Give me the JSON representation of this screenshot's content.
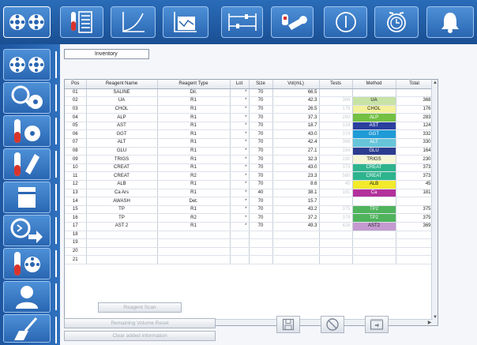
{
  "search": {
    "value": "Inventory"
  },
  "table": {
    "columns": [
      "Pos",
      "Reagent Name",
      "Reagent Type",
      "Lot",
      "Size",
      "Vol(mL)",
      "Tests",
      "Method",
      "Total"
    ],
    "rows": [
      {
        "pos": "01",
        "name": "SALINE",
        "type": "Dil.",
        "lot": "*",
        "size": "70",
        "vol": "66.5",
        "tests": "",
        "method": "",
        "method_color": "",
        "total": ""
      },
      {
        "pos": "02",
        "name": "UA",
        "type": "R1",
        "lot": "*",
        "size": "70",
        "vol": "42.3",
        "tests": "368",
        "method": "UA",
        "method_color": "#c7e3a6",
        "total": "368"
      },
      {
        "pos": "03",
        "name": "CHOL",
        "type": "R1",
        "lot": "*",
        "size": "70",
        "vol": "26.5",
        "tests": "176",
        "method": "CHOL",
        "method_color": "#f3f19a",
        "total": "176"
      },
      {
        "pos": "04",
        "name": "ALP",
        "type": "R1",
        "lot": "*",
        "size": "70",
        "vol": "37.3",
        "tests": "283",
        "method": "ALP",
        "method_color": "#74c043",
        "total": "283"
      },
      {
        "pos": "05",
        "name": "AST",
        "type": "R1",
        "lot": "*",
        "size": "70",
        "vol": "18.7",
        "tests": "124",
        "method": "AST",
        "method_color": "#2a3f9e",
        "total": "124"
      },
      {
        "pos": "06",
        "name": "GGT",
        "type": "R1",
        "lot": "*",
        "size": "70",
        "vol": "43.0",
        "tests": "374",
        "method": "GGT",
        "method_color": "#1f9bd7",
        "total": "332"
      },
      {
        "pos": "07",
        "name": "ALT",
        "type": "R1",
        "lot": "*",
        "size": "70",
        "vol": "42.4",
        "tests": "368",
        "method": "ALT",
        "method_color": "#67c5d9",
        "total": "330"
      },
      {
        "pos": "08",
        "name": "GLU",
        "type": "R1",
        "lot": "*",
        "size": "70",
        "vol": "27.1",
        "tests": "164",
        "method": "GLU",
        "method_color": "#2b3c8f",
        "total": "164"
      },
      {
        "pos": "09",
        "name": "TRIGS",
        "type": "R1",
        "lot": "*",
        "size": "70",
        "vol": "32.3",
        "tests": "230",
        "method": "TRIGS",
        "method_color": "#f5f6d6",
        "total": "230"
      },
      {
        "pos": "10",
        "name": "CREAT",
        "type": "R1",
        "lot": "*",
        "size": "70",
        "vol": "43.0",
        "tests": "373",
        "method": "CREAT",
        "method_color": "#2eb48d",
        "total": "373"
      },
      {
        "pos": "11",
        "name": "CREAT",
        "type": "R2",
        "lot": "*",
        "size": "70",
        "vol": "23.3",
        "tests": "580",
        "method": "CREAT",
        "method_color": "#2eb48d",
        "total": "373"
      },
      {
        "pos": "12",
        "name": "ALB",
        "type": "R1",
        "lot": "*",
        "size": "70",
        "vol": "8.6",
        "tests": "45",
        "method": "ALB",
        "method_color": "#f2ea2a",
        "total": "45"
      },
      {
        "pos": "13",
        "name": "Ca Ars",
        "type": "R1",
        "lot": "*",
        "size": "40",
        "vol": "38.1",
        "tests": "181",
        "method": "Ca",
        "method_color": "#b3309c",
        "total": "181"
      },
      {
        "pos": "14",
        "name": "AWASH",
        "type": "Det.",
        "lot": "*",
        "size": "70",
        "vol": "15.7",
        "tests": "",
        "method": "",
        "method_color": "",
        "total": ""
      },
      {
        "pos": "15",
        "name": "TP",
        "type": "R1",
        "lot": "*",
        "size": "70",
        "vol": "43.2",
        "tests": "375",
        "method": "TP2",
        "method_color": "#4fb35c",
        "total": "375"
      },
      {
        "pos": "16",
        "name": "TP",
        "type": "R2",
        "lot": "*",
        "size": "70",
        "vol": "37.2",
        "tests": "379",
        "method": "TP2",
        "method_color": "#4fb35c",
        "total": "375"
      },
      {
        "pos": "17",
        "name": "AST 2",
        "type": "R1",
        "lot": "*",
        "size": "70",
        "vol": "49.3",
        "tests": "426",
        "method": "AST2",
        "method_color": "#c49ad0",
        "total": "369"
      },
      {
        "pos": "18",
        "name": "",
        "type": "",
        "lot": "",
        "size": "",
        "vol": "",
        "tests": "",
        "method": "",
        "method_color": "",
        "total": ""
      },
      {
        "pos": "19",
        "name": "",
        "type": "",
        "lot": "",
        "size": "",
        "vol": "",
        "tests": "",
        "method": "",
        "method_color": "",
        "total": ""
      },
      {
        "pos": "20",
        "name": "",
        "type": "",
        "lot": "",
        "size": "",
        "vol": "",
        "tests": "",
        "method": "",
        "method_color": "",
        "total": ""
      },
      {
        "pos": "21",
        "name": "",
        "type": "",
        "lot": "",
        "size": "",
        "vol": "",
        "tests": "",
        "method": "",
        "method_color": "",
        "total": ""
      }
    ]
  },
  "buttons": {
    "reagent_scan": "Reagent Scan",
    "remaining_volume_reset": "Remaining Volume Reset",
    "clear_added_information": "Clear added information"
  },
  "toolbar_icons": [
    "bottles-icon",
    "test-list-icon",
    "calibration-curve-icon",
    "qc-chart-icon",
    "settings-sliders-icon",
    "maintenance-tools-icon",
    "power-icon",
    "alarm-clock-icon",
    "bell-icon"
  ],
  "sidebar_icons": [
    "bottles-icon",
    "sample-search-icon",
    "test-tube-rack-icon",
    "cuvette-icon",
    "reagent-container-icon",
    "run-arrow-icon",
    "reagent-tray-icon",
    "user-icon",
    "cleaning-brush-icon"
  ],
  "colors": {
    "topbar": "#1a4f93",
    "button_blue": "#3a7cc8",
    "accent": "#9ec4ee"
  }
}
